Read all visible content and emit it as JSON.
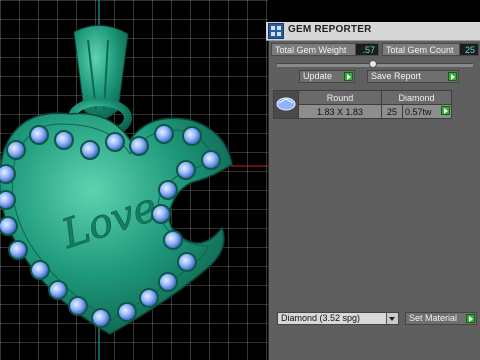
{
  "panel": {
    "title": "GEM REPORTER",
    "total_weight_label": "Total Gem Weight",
    "total_weight_value": ".57",
    "total_count_label": "Total Gem Count",
    "total_count_value": "25",
    "update_label": "Update",
    "save_report_label": "Save Report",
    "table": {
      "headers": [
        "Round",
        "Diamond"
      ],
      "size": "1.83 X 1.83",
      "count": "25",
      "weight": "0.57tw"
    },
    "material_select": "Diamond     (3.52 spg)",
    "set_material_label": "Set Material"
  },
  "viewport": {
    "engraving": "Love"
  },
  "colors": {
    "metal": "#1f9a7c",
    "gem": "#8fb4ff",
    "grid": "#d9d9d9",
    "accent_go": "#2fb02f"
  }
}
